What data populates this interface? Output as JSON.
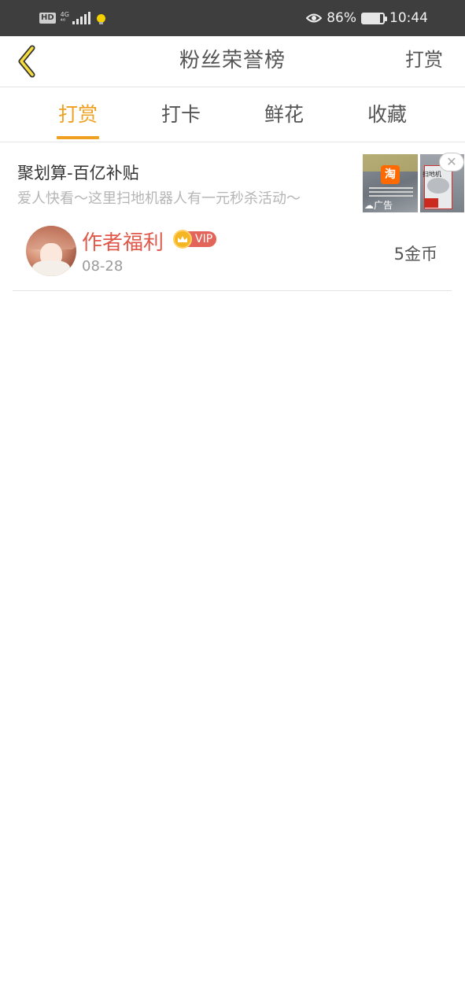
{
  "status_bar": {
    "hd": "HD",
    "network": "4G",
    "network_sub": "⁴⁶",
    "battery_percent": "86%",
    "battery_level": 0.86,
    "time": "10:44"
  },
  "header": {
    "back_icon": "chevron-left-icon",
    "title": "粉丝荣誉榜",
    "action_label": "打赏"
  },
  "tabs": [
    {
      "label": "打赏",
      "active": true
    },
    {
      "label": "打卡",
      "active": false
    },
    {
      "label": "鲜花",
      "active": false
    },
    {
      "label": "收藏",
      "active": false
    }
  ],
  "ad": {
    "title": "聚划算-百亿补贴",
    "subtitle": "爱人快看～这里扫地机器人有一元秒杀活动～",
    "tag": "广告",
    "logo_char": "淘",
    "product_label": "扫地机"
  },
  "ranking": [
    {
      "name": "作者福利",
      "vip_label": "VIP",
      "date": "08-28",
      "amount": "5金币"
    }
  ],
  "colors": {
    "accent": "#f0a020",
    "name_red": "#e0584a",
    "status_bar_bg": "#3e3e3e"
  }
}
